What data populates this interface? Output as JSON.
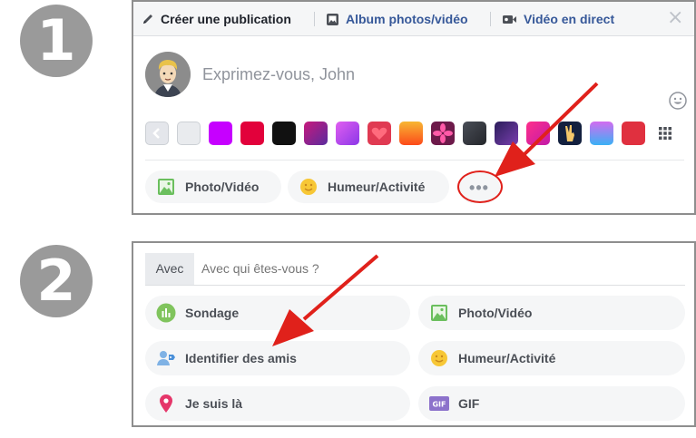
{
  "badges": {
    "step1": "1",
    "step2": "2"
  },
  "panel1": {
    "tabs": [
      {
        "label": "Créer une publication",
        "icon": "pencil-icon"
      },
      {
        "label": "Album photos/vidéo",
        "icon": "album-icon"
      },
      {
        "label": "Vidéo en direct",
        "icon": "video-camera-icon"
      }
    ],
    "close_icon": "×",
    "composer_placeholder": "Exprimez-vous, John",
    "background_colors": [
      "#e9ebee",
      "#c600ff",
      "#e2013b",
      "#111111",
      "#8a27a8",
      "#ad47f0",
      "#e03a52",
      "#f7891e",
      "#6d1a4a",
      "#3b3e45",
      "#3a2f6b",
      "#d81a91",
      "#13203f",
      "#4a7cf5",
      "#e0303f"
    ],
    "actions": [
      {
        "label": "Photo/Vidéo",
        "icon": "photo-icon"
      },
      {
        "label": "Humeur/Activité",
        "icon": "emoji-icon"
      },
      {
        "label": "•••",
        "icon": "more-icon"
      }
    ]
  },
  "panel2": {
    "with_label": "Avec",
    "with_placeholder": "Avec qui êtes-vous ?",
    "options": [
      {
        "label": "Sondage",
        "icon": "poll-icon"
      },
      {
        "label": "Photo/Vidéo",
        "icon": "photo-icon"
      },
      {
        "label": "Identifier des amis",
        "icon": "tag-friends-icon"
      },
      {
        "label": "Humeur/Activité",
        "icon": "emoji-icon"
      },
      {
        "label": "Je suis là",
        "icon": "location-pin-icon"
      },
      {
        "label": "GIF",
        "icon": "gif-icon"
      }
    ]
  },
  "colors": {
    "link": "#365899",
    "annotation_red": "#e0211b",
    "pill_bg": "#f5f6f7"
  }
}
